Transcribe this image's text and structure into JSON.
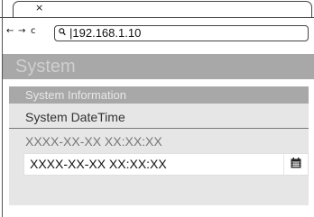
{
  "browser": {
    "tab_close_glyph": "×",
    "back_glyph": "←",
    "forward_glyph": "→",
    "reload_glyph": "c",
    "search_icon": "search-icon",
    "address": "192.168.1.10"
  },
  "page": {
    "title": "System",
    "panel_title": "System Information",
    "section_title": "System DateTime",
    "datetime_readonly": "XXXX-XX-XX XX:XX:XX",
    "datetime_input_value": "XXXX-XX-XX XX:XX:XX",
    "calendar_icon": "calendar-icon"
  },
  "colors": {
    "header_bg": "#a8a8a8",
    "panel_bg": "#e6e6e6"
  }
}
